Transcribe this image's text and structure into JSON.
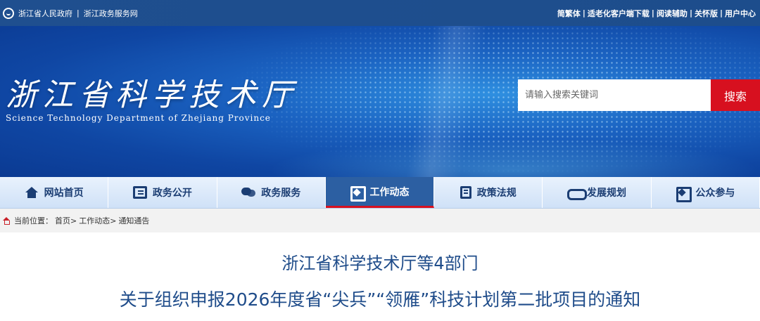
{
  "topbar": {
    "left_links": [
      "浙江省人民政府",
      "浙江政务服务网"
    ],
    "right_links": [
      "简繁体",
      "适老化客户端下载",
      "阅读辅助",
      "关怀版",
      "用户中心"
    ]
  },
  "banner": {
    "title": "浙江省科学技术厅",
    "subtitle": "Science Technology Department of Zhejiang Province"
  },
  "search": {
    "placeholder": "请输入搜索关键词",
    "button": "搜索"
  },
  "nav": {
    "items": [
      {
        "label": "网站首页",
        "icon": "home-icon"
      },
      {
        "label": "政务公开",
        "icon": "gov-open-icon"
      },
      {
        "label": "政务服务",
        "icon": "chat-icon"
      },
      {
        "label": "工作动态",
        "icon": "work-icon",
        "active": true
      },
      {
        "label": "政策法规",
        "icon": "policy-icon"
      },
      {
        "label": "发展规划",
        "icon": "handshake-icon"
      },
      {
        "label": "公众参与",
        "icon": "public-icon"
      }
    ]
  },
  "breadcrumb": {
    "prefix": "当前位置：",
    "items": [
      "首页>",
      "工作动态>",
      "通知通告"
    ]
  },
  "article": {
    "title_line1": "浙江省科学技术厅等4部门",
    "title_line2": "关于组织申报2026年度省“尖兵”“领雁”科技计划第二批项目的通知"
  },
  "colors": {
    "topbar": "#1f4f8f",
    "search_button": "#d7101f",
    "nav_active": "#2c5fa2",
    "title_text": "#1f4c8a"
  }
}
